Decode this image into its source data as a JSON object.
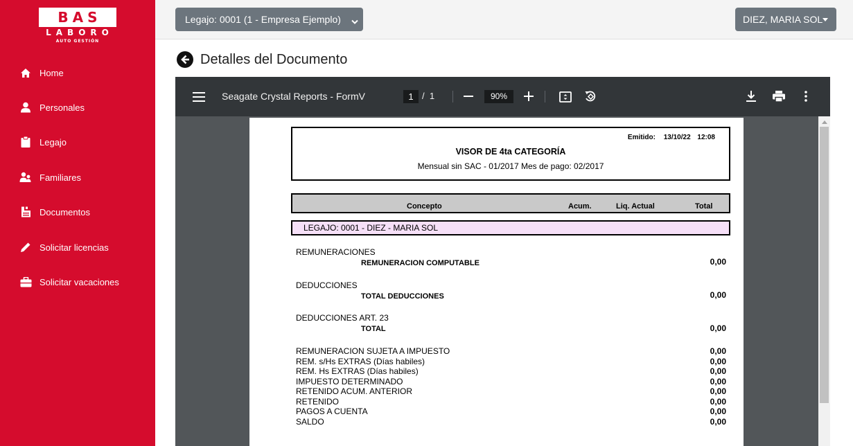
{
  "brand": {
    "line1": "BAS",
    "line2": "LABORO",
    "line3": "AUTO GESTIÓN",
    "color": "#d50c2d"
  },
  "sidebar": {
    "items": [
      {
        "label": "Home",
        "icon": "home-icon"
      },
      {
        "label": "Personales",
        "icon": "person-icon"
      },
      {
        "label": "Legajo",
        "icon": "clipboard-icon"
      },
      {
        "label": "Familiares",
        "icon": "family-icon"
      },
      {
        "label": "Documentos",
        "icon": "document-icon"
      },
      {
        "label": "Solicitar licencias",
        "icon": "pencil-icon"
      },
      {
        "label": "Solicitar vacaciones",
        "icon": "briefcase-icon"
      }
    ]
  },
  "header": {
    "legajo_select": "Legajo: 0001 (1 - Empresa Ejemplo)",
    "user_menu": "DIEZ, MARIA SOL"
  },
  "page": {
    "title": "Detalles del Documento"
  },
  "viewer": {
    "doc_name": "Seagate Crystal Reports - FormV",
    "current_page": "1",
    "page_sep": "/",
    "total_pages": "1",
    "zoom": "90%"
  },
  "report": {
    "emitido_label": "Emitido:",
    "emitido_date": "13/10/22",
    "emitido_time": "12:08",
    "title": "VISOR DE 4ta CATEGORÍA",
    "subtitle": "Mensual sin SAC - 01/2017  Mes de pago: 02/2017",
    "columns": {
      "concepto": "Concepto",
      "acum": "Acum.",
      "liq_actual": "Liq. Actual",
      "total": "Total"
    },
    "legajo_line": "LEGAJO: 0001 - DIEZ - MARIA SOL",
    "sections": [
      {
        "label": "REMUNERACIONES",
        "total_label": "REMUNERACION COMPUTABLE",
        "value": "0,00"
      },
      {
        "label": "DEDUCCIONES",
        "total_label": "TOTAL DEDUCCIONES",
        "value": "0,00"
      },
      {
        "label": "DEDUCCIONES ART. 23",
        "total_label": "TOTAL",
        "value": "0,00"
      }
    ],
    "summary": [
      {
        "label": "REMUNERACION SUJETA A IMPUESTO",
        "value": "0,00"
      },
      {
        "label": "REM. s/Hs EXTRAS (Días habiles)",
        "value": "0,00"
      },
      {
        "label": "REM. Hs EXTRAS (Días habiles)",
        "value": "0,00"
      },
      {
        "label": "IMPUESTO DETERMINADO",
        "value": "0,00"
      },
      {
        "label": "RETENIDO ACUM. ANTERIOR",
        "value": "0,00"
      },
      {
        "label": "RETENIDO",
        "value": "0,00"
      },
      {
        "label": "PAGOS A CUENTA",
        "value": "0,00"
      },
      {
        "label": "SALDO",
        "value": "0,00"
      }
    ]
  }
}
